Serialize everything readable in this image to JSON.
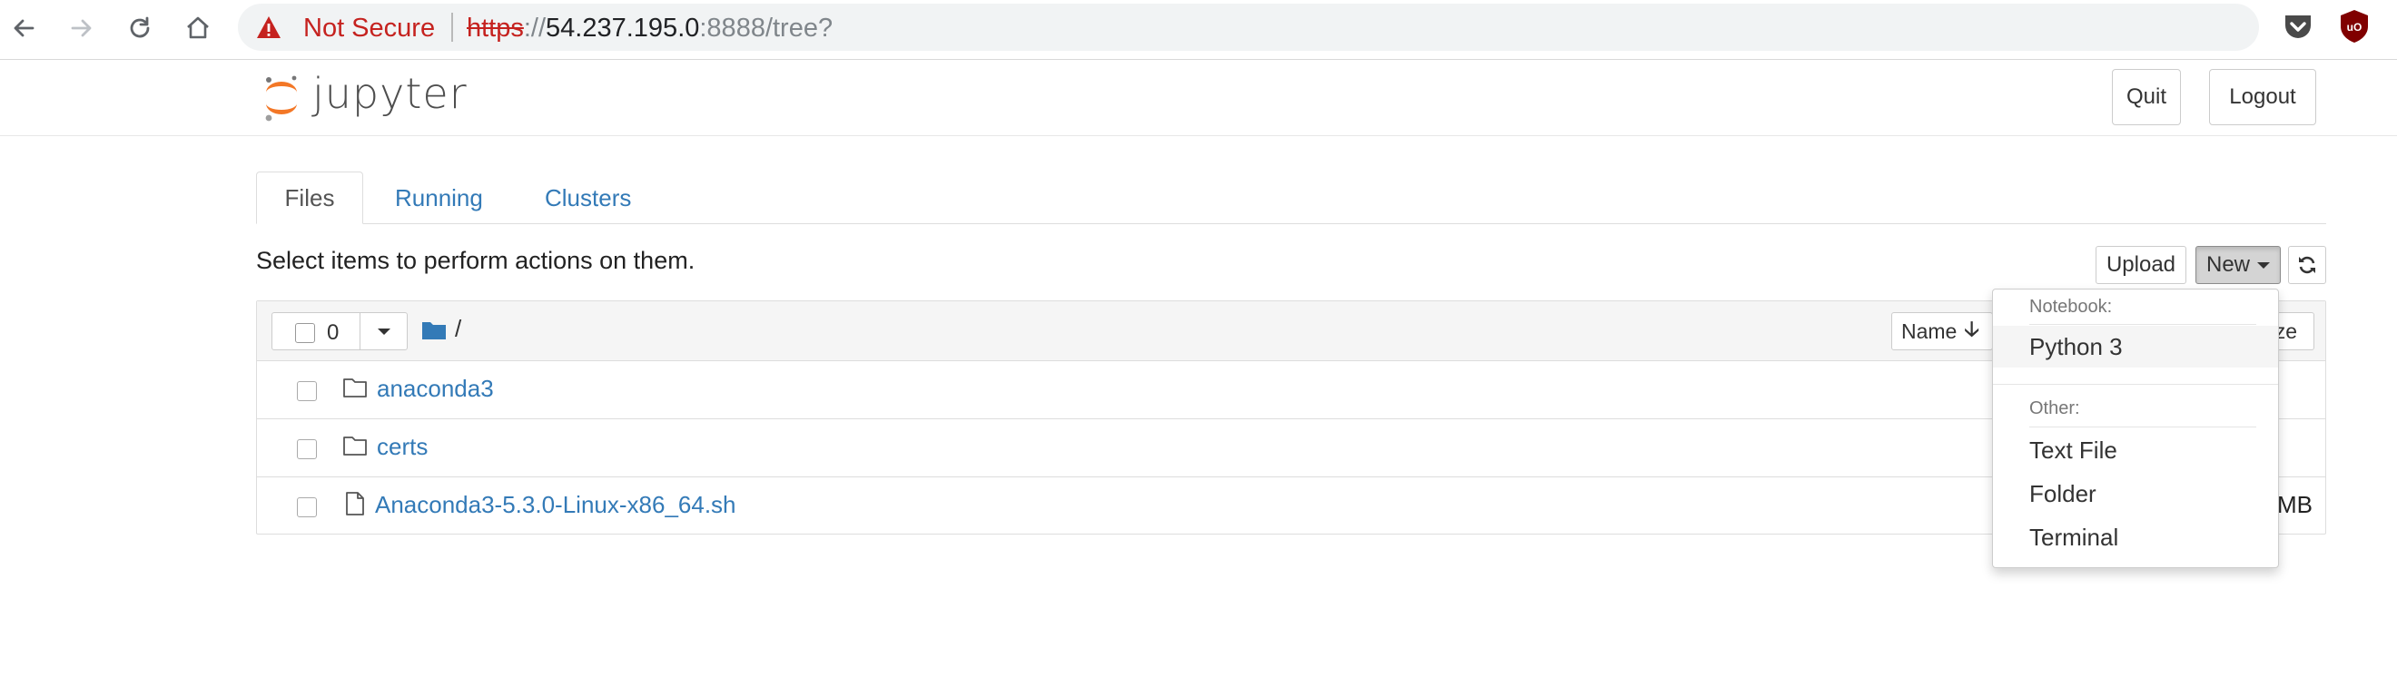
{
  "browser": {
    "security_label": "Not Secure",
    "url_scheme": "https",
    "url_sep": "://",
    "url_host": "54.237.195.0",
    "url_rest": ":8888/tree?"
  },
  "header": {
    "logo_text": "jupyter",
    "quit_label": "Quit",
    "logout_label": "Logout"
  },
  "tabs": [
    {
      "label": "Files",
      "active": true
    },
    {
      "label": "Running",
      "active": false
    },
    {
      "label": "Clusters",
      "active": false
    }
  ],
  "toolbar": {
    "hint": "Select items to perform actions on them.",
    "upload_label": "Upload",
    "new_label": "New"
  },
  "list_header": {
    "selected_count": "0",
    "breadcrumb": "/",
    "sort_label": "Name",
    "sort_arrow": "🡣",
    "size_label": "ze"
  },
  "files": [
    {
      "name": "anaconda3",
      "type": "folder",
      "size": ""
    },
    {
      "name": "certs",
      "type": "folder",
      "size": ""
    },
    {
      "name": "Anaconda3-5.3.0-Linux-x86_64.sh",
      "type": "file",
      "size": "MB"
    }
  ],
  "new_menu": {
    "notebook_header": "Notebook:",
    "notebook_items": [
      "Python 3"
    ],
    "other_header": "Other:",
    "other_items": [
      "Text File",
      "Folder",
      "Terminal"
    ]
  },
  "colors": {
    "link": "#337ab7",
    "warning": "#c5221f",
    "logo_orange": "#f37726"
  }
}
